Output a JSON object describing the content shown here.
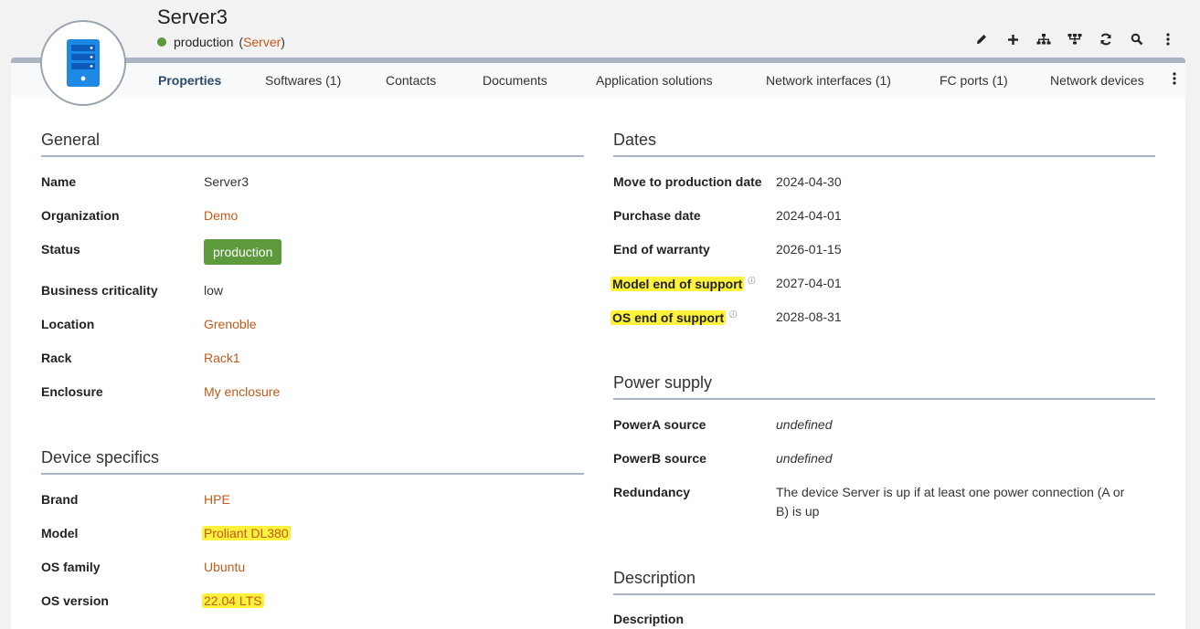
{
  "header": {
    "title": "Server3",
    "status": "production",
    "class_open": "(",
    "class_name": "Server",
    "class_close": ")",
    "toolbar_icons": [
      "pencil-icon",
      "plus-icon",
      "sitemap-icon",
      "network-icon",
      "refresh-icon",
      "search-icon",
      "more-vertical-icon"
    ]
  },
  "tabs": [
    {
      "label": "Properties"
    },
    {
      "label": "Softwares (1)"
    },
    {
      "label": "Contacts"
    },
    {
      "label": "Documents"
    },
    {
      "label": "Application solutions"
    },
    {
      "label": "Network interfaces (1)"
    },
    {
      "label": "FC ports (1)"
    },
    {
      "label": "Network devices"
    }
  ],
  "general": {
    "title": "General",
    "rows": [
      {
        "label": "Name",
        "value": "Server3"
      },
      {
        "label": "Organization",
        "value": "Demo"
      },
      {
        "label": "Status",
        "value": "production"
      },
      {
        "label": "Business criticality",
        "value": "low"
      },
      {
        "label": "Location",
        "value": "Grenoble"
      },
      {
        "label": "Rack",
        "value": "Rack1"
      },
      {
        "label": "Enclosure",
        "value": "My enclosure"
      }
    ]
  },
  "device": {
    "title": "Device specifics",
    "rows": [
      {
        "label": "Brand",
        "value": "HPE"
      },
      {
        "label": "Model",
        "value": "Proliant DL380"
      },
      {
        "label": "OS family",
        "value": "Ubuntu"
      },
      {
        "label": "OS version",
        "value": "22.04 LTS"
      }
    ]
  },
  "dates": {
    "title": "Dates",
    "rows": [
      {
        "label": "Move to production date",
        "value": "2024-04-30"
      },
      {
        "label": "Purchase date",
        "value": "2024-04-01"
      },
      {
        "label": "End of warranty",
        "value": "2026-01-15"
      },
      {
        "label": "Model end of support",
        "value": "2027-04-01"
      },
      {
        "label": "OS end of support",
        "value": "2028-08-31"
      }
    ]
  },
  "power": {
    "title": "Power supply",
    "rows": [
      {
        "label": "PowerA source",
        "value": "undefined"
      },
      {
        "label": "PowerB source",
        "value": "undefined"
      },
      {
        "label": "Redundancy",
        "value": "The device Server is up if at least one power connection (A or",
        "value2": "B) is up"
      }
    ]
  },
  "description": {
    "title": "Description",
    "partial_label": "Description"
  },
  "colors": {
    "accent_link": "#c25a1a",
    "status_green": "#5c9a3b",
    "highlight": "#fff23a",
    "rule": "#aab4c2"
  }
}
